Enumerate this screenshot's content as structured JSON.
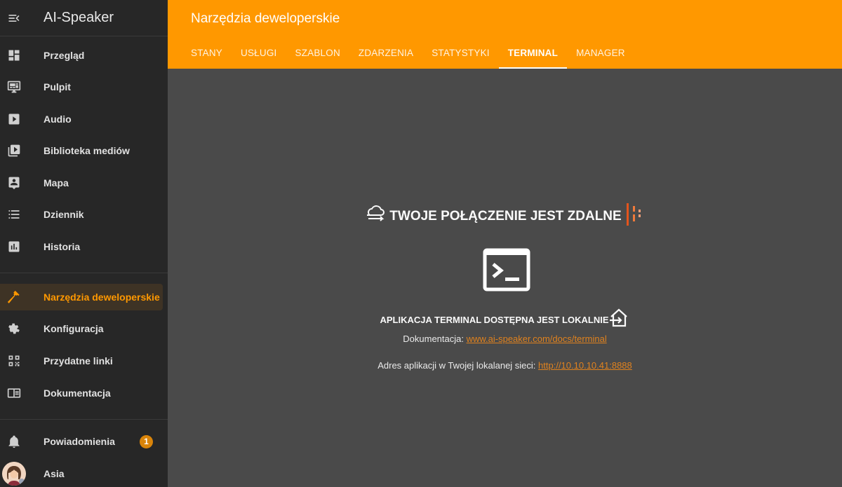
{
  "app": {
    "title": "AI-Speaker"
  },
  "sidebar": {
    "items": [
      {
        "label": "Przegląd",
        "icon": "dashboard-icon"
      },
      {
        "label": "Pulpit",
        "icon": "monitor-dashboard-icon"
      },
      {
        "label": "Audio",
        "icon": "play-box-icon"
      },
      {
        "label": "Biblioteka mediów",
        "icon": "play-box-multiple-icon"
      },
      {
        "label": "Mapa",
        "icon": "account-location-icon"
      },
      {
        "label": "Dziennik",
        "icon": "format-list-icon"
      },
      {
        "label": "Historia",
        "icon": "chart-box-icon"
      },
      {
        "label": "Narzędzia deweloperskie",
        "icon": "hammer-icon"
      },
      {
        "label": "Konfiguracja",
        "icon": "cog-icon"
      },
      {
        "label": "Przydatne linki",
        "icon": "qrcode-icon"
      },
      {
        "label": "Dokumentacja",
        "icon": "book-icon"
      }
    ],
    "notifications": {
      "label": "Powiadomienia",
      "count": "1"
    },
    "user": {
      "name": "Asia"
    }
  },
  "header": {
    "title": "Narzędzia deweloperskie",
    "tabs": [
      "STANY",
      "USŁUGI",
      "SZABLON",
      "ZDARZENIA",
      "STATYSTYKI",
      "TERMINAL",
      "MANAGER"
    ],
    "active_tab": "TERMINAL"
  },
  "main": {
    "remote_title": "TWOJE POŁĄCZENIE JEST ZDALNE",
    "local_title": "APLIKACJA TERMINAL DOSTĘPNA JEST LOKALNIE",
    "docs_label": "Dokumentacja: ",
    "docs_link": "www.ai-speaker.com/docs/terminal",
    "address_label": "Adres aplikacji w Twojej lokalanej sieci: ",
    "address_link": "http://10.10.10.41:8888"
  },
  "colors": {
    "accent": "#ff9800",
    "sidebar_bg": "#272727",
    "main_bg": "#4a4a4a",
    "link": "#e0821e",
    "badge": "#d9840a"
  }
}
